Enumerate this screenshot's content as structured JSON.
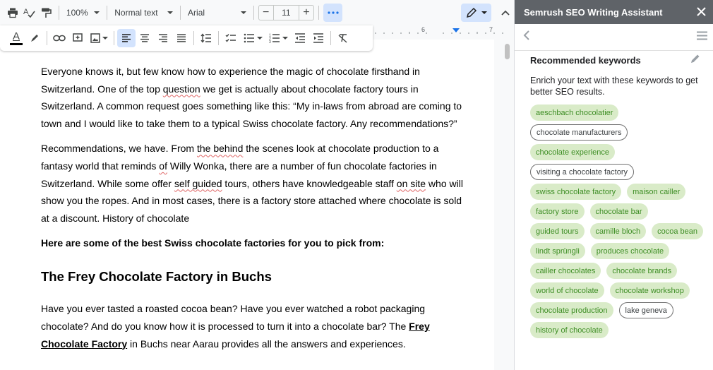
{
  "toolbar": {
    "zoom": "100%",
    "style": "Normal text",
    "font": "Arial",
    "font_size": "11",
    "minus": "−",
    "plus": "+"
  },
  "ruler": {
    "labels": [
      "6",
      "7"
    ]
  },
  "document": {
    "p1": [
      {
        "t": "Everyone knows it, but few know how to experience the magic of chocolate firsthand in Switzerland. One of the top "
      },
      {
        "t": "question",
        "spell": true
      },
      {
        "t": " we get is actually about chocolate factory tours in Switzerland. A common request goes something like this: “My in-laws from abroad are coming to town and I would like to take them to a typical Swiss chocolate factory. Any recommendations?”"
      }
    ],
    "p2": [
      {
        "t": "Recommendations, we have. From "
      },
      {
        "t": "the behind",
        "spell": true
      },
      {
        "t": " the scenes look at chocolate production to a fantasy world that reminds "
      },
      {
        "t": "of",
        "spell": true
      },
      {
        "t": " Willy Wonka, there are a number of fun chocolate factories in Switzerland. While some offer "
      },
      {
        "t": "self guided",
        "spell": true
      },
      {
        "t": " tours, others have knowledgeable staff "
      },
      {
        "t": "on site",
        "spell": true
      },
      {
        "t": " who will show you the ropes. And in most cases, there is a factory store attached where chocolate is sold at a discount. History of chocolate"
      }
    ],
    "bold_line": "Here are some of the best Swiss chocolate factories for you to pick from:",
    "heading": "The Frey Chocolate Factory in Buchs",
    "p3": [
      {
        "t": "Have you ever tasted a roasted cocoa bean? Have you ever watched a robot packaging chocolate? And do you know how it is processed to turn it into a chocolate bar? The "
      },
      {
        "t": "Frey Chocolate Factory",
        "link": true
      },
      {
        "t": " in Buchs near Aarau provides all the answers and experiences."
      }
    ]
  },
  "sidebar": {
    "title": "Semrush SEO Writing Assistant",
    "section_title": "Recommended keywords",
    "description": "Enrich your text with these keywords to get better SEO results.",
    "keywords": [
      {
        "text": "aeschbach chocolatier",
        "used": true
      },
      {
        "text": "chocolate manufacturers",
        "used": false
      },
      {
        "text": "chocolate experience",
        "used": true
      },
      {
        "text": "visiting a chocolate factory",
        "used": false
      },
      {
        "text": "swiss chocolate factory",
        "used": true
      },
      {
        "text": "maison cailler",
        "used": true
      },
      {
        "text": "factory store",
        "used": true
      },
      {
        "text": "chocolate bar",
        "used": true
      },
      {
        "text": "guided tours",
        "used": true
      },
      {
        "text": "camille bloch",
        "used": true
      },
      {
        "text": "cocoa bean",
        "used": true
      },
      {
        "text": "lindt sprüngli",
        "used": true
      },
      {
        "text": "produces chocolate",
        "used": true
      },
      {
        "text": "cailler chocolates",
        "used": true
      },
      {
        "text": "chocolate brands",
        "used": true
      },
      {
        "text": "world of chocolate",
        "used": true
      },
      {
        "text": "chocolate workshop",
        "used": true
      },
      {
        "text": "chocolate production",
        "used": true
      },
      {
        "text": "lake geneva",
        "used": false
      },
      {
        "text": "history of chocolate",
        "used": true
      }
    ]
  },
  "colors": {
    "keyword_used_bg": "#d9ebc8",
    "keyword_used_text": "#3e8e25",
    "sidebar_header": "#5f6368",
    "spellcheck": "#e06666",
    "accent": "#1a73e8"
  }
}
